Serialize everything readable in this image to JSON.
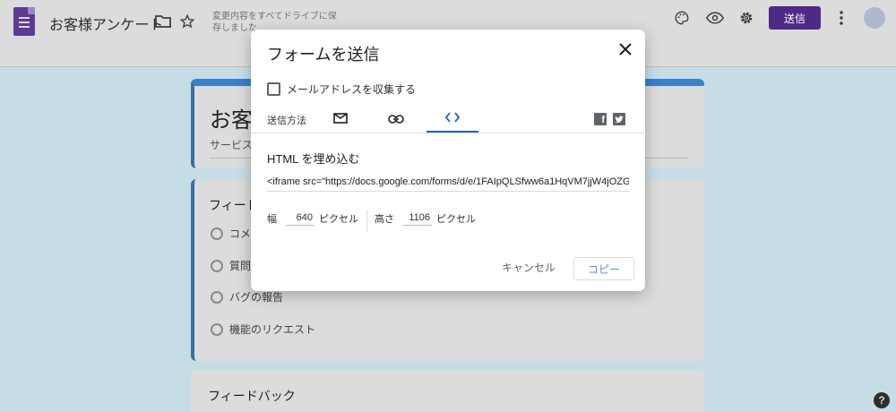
{
  "header": {
    "doc_title": "お客様アンケート",
    "save_status": "変更内容をすべてドライブに保存しました",
    "send_label": "送信",
    "icons": [
      "forms-logo",
      "folder-icon",
      "star-icon",
      "palette-icon",
      "eye-icon",
      "gear-icon",
      "more-vert-icon"
    ]
  },
  "form": {
    "title": "お客",
    "description": "サービスの",
    "question_title": "フィード",
    "options": [
      "コメン",
      "質問",
      "バグの報告",
      "機能のリクエスト"
    ],
    "second_card_title": "フィードバック"
  },
  "dialog": {
    "title": "フォームを送信",
    "collect_email_label": "メールアドレスを収集する",
    "collect_email_checked": false,
    "send_via_label": "送信方法",
    "tabs": [
      {
        "icon": "mail-icon",
        "active": false
      },
      {
        "icon": "link-icon",
        "active": false
      },
      {
        "icon": "embed-code-icon",
        "active": true
      }
    ],
    "embed_title": "HTML を埋め込む",
    "embed_code": "<iframe src=\"https://docs.google.com/forms/d/e/1FAIpQLSfww6a1HqVM7jjW4jOZG(",
    "width_label": "幅",
    "width_value": "640",
    "height_label": "高さ",
    "height_value": "1106",
    "unit_label": "ピクセル",
    "cancel_label": "キャンセル",
    "copy_label": "コピー"
  },
  "colors": {
    "accent_purple": "#4f2a85",
    "form_blue": "#3a82c8",
    "tab_active": "#1565c0",
    "backdrop": "#c7dde6"
  }
}
